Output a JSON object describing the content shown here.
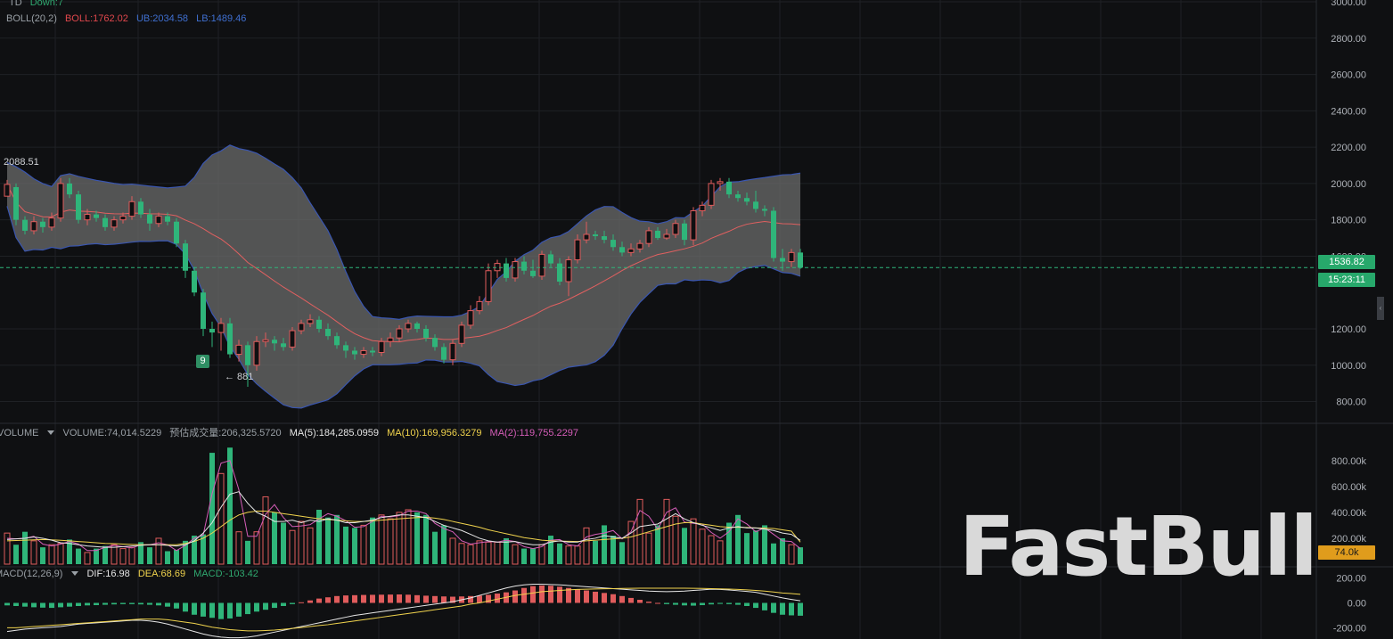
{
  "legend": {
    "td": "TD",
    "td_down": "Down:7",
    "boll_name": "BOLL(20,2)",
    "boll_mid": "BOLL:1762.02",
    "boll_ub": "UB:2034.58",
    "boll_lb": "LB:1489.46",
    "volume_name": "VOLUME",
    "volume_value": "VOLUME:74,014.5229",
    "volume_est": "预估成交量:206,325.5720",
    "ma5": "MA(5):184,285.0959",
    "ma10": "MA(10):169,956.3279",
    "ma2": "MA(2):119,755.2297",
    "macd_name": "MACD(12,26,9)",
    "dif": "DIF:16.98",
    "dea": "DEA:68.69",
    "macd": "MACD:-103.42"
  },
  "annotations": {
    "high": "2088.51",
    "low": "← 881",
    "td_count": "9"
  },
  "last_price": "1536.82",
  "countdown": "15:23:11",
  "last_volume": "74.0k",
  "watermark": "FastBull",
  "colors": {
    "up": "#e05c5c",
    "down": "#2fb57a",
    "boll_band": "#6b6b6b",
    "boll_edge": "#3a56b0",
    "boll_mid": "#e06060",
    "ma5": "#e6e6e6",
    "ma10": "#f0d34d",
    "ma2": "#d55db8",
    "grid": "#1f2125"
  },
  "chart_data": [
    {
      "type": "candlestick",
      "price_axis_ticks": [
        3000,
        2800,
        2600,
        2400,
        2200,
        2000,
        1800,
        1600,
        1200,
        1000,
        800
      ],
      "ylim": [
        680,
        3010
      ],
      "grid": true,
      "candles": [
        [
          1930,
          1995,
          1950,
          2020
        ],
        [
          1980,
          1800,
          1770,
          2000
        ],
        [
          1800,
          1740,
          1720,
          1820
        ],
        [
          1740,
          1790,
          1720,
          1820
        ],
        [
          1790,
          1760,
          1730,
          1810
        ],
        [
          1760,
          1810,
          1740,
          1840
        ],
        [
          1810,
          2000,
          1790,
          2030
        ],
        [
          2000,
          1940,
          1920,
          2030
        ],
        [
          1940,
          1800,
          1780,
          1960
        ],
        [
          1800,
          1830,
          1770,
          1860
        ],
        [
          1830,
          1810,
          1790,
          1850
        ],
        [
          1810,
          1760,
          1740,
          1830
        ],
        [
          1760,
          1800,
          1740,
          1820
        ],
        [
          1800,
          1820,
          1780,
          1840
        ],
        [
          1820,
          1900,
          1800,
          1930
        ],
        [
          1900,
          1830,
          1810,
          1920
        ],
        [
          1830,
          1780,
          1740,
          1860
        ],
        [
          1780,
          1820,
          1760,
          1840
        ],
        [
          1820,
          1790,
          1770,
          1840
        ],
        [
          1790,
          1670,
          1650,
          1810
        ],
        [
          1670,
          1520,
          1480,
          1690
        ],
        [
          1520,
          1400,
          1380,
          1540
        ],
        [
          1400,
          1200,
          1160,
          1420
        ],
        [
          1200,
          1180,
          1100,
          1240
        ],
        [
          1180,
          1230,
          1080,
          1260
        ],
        [
          1230,
          1060,
          1040,
          1260
        ],
        [
          1060,
          1110,
          1020,
          1140
        ],
        [
          1110,
          1000,
          881,
          1130
        ],
        [
          1000,
          1130,
          970,
          1160
        ],
        [
          1130,
          1140,
          1100,
          1180
        ],
        [
          1140,
          1120,
          1080,
          1160
        ],
        [
          1120,
          1100,
          1080,
          1150
        ],
        [
          1100,
          1190,
          1080,
          1210
        ],
        [
          1190,
          1230,
          1170,
          1250
        ],
        [
          1230,
          1250,
          1210,
          1280
        ],
        [
          1250,
          1200,
          1180,
          1270
        ],
        [
          1200,
          1160,
          1140,
          1230
        ],
        [
          1160,
          1110,
          1090,
          1180
        ],
        [
          1110,
          1080,
          1040,
          1130
        ],
        [
          1080,
          1060,
          1030,
          1100
        ],
        [
          1060,
          1080,
          1040,
          1100
        ],
        [
          1080,
          1070,
          1050,
          1100
        ],
        [
          1070,
          1130,
          1050,
          1150
        ],
        [
          1130,
          1150,
          1100,
          1180
        ],
        [
          1150,
          1200,
          1130,
          1220
        ],
        [
          1200,
          1230,
          1180,
          1250
        ],
        [
          1230,
          1200,
          1180,
          1240
        ],
        [
          1200,
          1150,
          1130,
          1220
        ],
        [
          1150,
          1100,
          1080,
          1170
        ],
        [
          1100,
          1030,
          1010,
          1120
        ],
        [
          1030,
          1120,
          1000,
          1140
        ],
        [
          1120,
          1220,
          1100,
          1240
        ],
        [
          1220,
          1300,
          1200,
          1330
        ],
        [
          1300,
          1350,
          1280,
          1380
        ],
        [
          1350,
          1520,
          1330,
          1560
        ],
        [
          1520,
          1560,
          1480,
          1580
        ],
        [
          1560,
          1480,
          1460,
          1590
        ],
        [
          1480,
          1570,
          1460,
          1590
        ],
        [
          1570,
          1520,
          1500,
          1600
        ],
        [
          1520,
          1490,
          1480,
          1580
        ],
        [
          1490,
          1610,
          1470,
          1630
        ],
        [
          1610,
          1560,
          1540,
          1630
        ],
        [
          1560,
          1460,
          1440,
          1590
        ],
        [
          1460,
          1580,
          1380,
          1600
        ],
        [
          1580,
          1690,
          1560,
          1720
        ],
        [
          1690,
          1720,
          1670,
          1790
        ],
        [
          1720,
          1710,
          1690,
          1740
        ],
        [
          1710,
          1690,
          1670,
          1740
        ],
        [
          1690,
          1650,
          1630,
          1720
        ],
        [
          1650,
          1620,
          1600,
          1680
        ],
        [
          1620,
          1640,
          1600,
          1670
        ],
        [
          1640,
          1670,
          1620,
          1690
        ],
        [
          1670,
          1740,
          1650,
          1760
        ],
        [
          1740,
          1700,
          1690,
          1760
        ],
        [
          1700,
          1720,
          1690,
          1750
        ],
        [
          1720,
          1780,
          1700,
          1800
        ],
        [
          1780,
          1690,
          1660,
          1800
        ],
        [
          1690,
          1850,
          1660,
          1870
        ],
        [
          1850,
          1880,
          1820,
          1900
        ],
        [
          1880,
          2000,
          1860,
          2020
        ],
        [
          2000,
          2010,
          1960,
          2030
        ],
        [
          2010,
          1940,
          1920,
          2030
        ],
        [
          1940,
          1920,
          1900,
          1960
        ],
        [
          1920,
          1900,
          1880,
          1950
        ],
        [
          1900,
          1860,
          1840,
          1960
        ],
        [
          1860,
          1850,
          1820,
          1880
        ],
        [
          1850,
          1590,
          1570,
          1870
        ],
        [
          1590,
          1570,
          1520,
          1640
        ],
        [
          1570,
          1620,
          1540,
          1640
        ],
        [
          1620,
          1537,
          1530,
          1640
        ]
      ]
    },
    {
      "type": "bar",
      "volume_axis_ticks": [
        "800.00k",
        "600.00k",
        "400.00k",
        "200.00k"
      ],
      "ylim": [
        0,
        950
      ],
      "volume": [
        240,
        150,
        250,
        180,
        130,
        150,
        160,
        190,
        120,
        90,
        120,
        140,
        150,
        120,
        130,
        170,
        130,
        200,
        100,
        110,
        180,
        220,
        230,
        860,
        700,
        900,
        250,
        180,
        250,
        520,
        400,
        320,
        260,
        330,
        280,
        420,
        360,
        380,
        290,
        280,
        300,
        360,
        380,
        350,
        400,
        420,
        400,
        380,
        250,
        300,
        200,
        160,
        150,
        180,
        170,
        170,
        200,
        150,
        120,
        120,
        150,
        220,
        160,
        140,
        140,
        280,
        180,
        300,
        220,
        170,
        330,
        500,
        240,
        300,
        500,
        370,
        280,
        350,
        270,
        220,
        180,
        320,
        380,
        240,
        260,
        300,
        160,
        200,
        150,
        130
      ],
      "ma5": [
        190,
        195,
        200,
        210,
        200,
        185,
        165,
        160,
        150,
        140,
        135,
        130,
        130,
        135,
        140,
        145,
        150,
        150,
        145,
        140,
        150,
        180,
        240,
        320,
        440,
        540,
        560,
        470,
        400,
        370,
        330,
        330,
        340,
        320,
        340,
        330,
        350,
        340,
        320,
        320,
        330,
        340,
        360,
        370,
        380,
        380,
        370,
        360,
        330,
        300,
        280,
        260,
        230,
        200,
        180,
        170,
        170,
        175,
        160,
        150,
        150,
        170,
        180,
        170,
        170,
        190,
        200,
        220,
        210,
        200,
        240,
        290,
        300,
        310,
        350,
        390,
        350,
        320,
        300,
        280,
        260,
        280,
        290,
        280,
        280,
        270,
        260,
        240,
        230,
        184
      ],
      "ma10": [
        180,
        182,
        185,
        188,
        190,
        188,
        184,
        180,
        175,
        170,
        165,
        160,
        158,
        155,
        152,
        150,
        150,
        150,
        150,
        150,
        160,
        175,
        200,
        240,
        290,
        340,
        380,
        400,
        410,
        410,
        400,
        390,
        380,
        370,
        360,
        350,
        345,
        340,
        335,
        330,
        330,
        335,
        340,
        345,
        350,
        355,
        360,
        362,
        355,
        345,
        330,
        315,
        300,
        285,
        265,
        250,
        235,
        220,
        205,
        195,
        185,
        180,
        178,
        176,
        175,
        180,
        185,
        190,
        195,
        200,
        210,
        230,
        250,
        270,
        290,
        310,
        320,
        320,
        310,
        300,
        290,
        285,
        285,
        283,
        280,
        278,
        275,
        265,
        255,
        170
      ],
      "ma2": [
        200,
        195,
        200,
        215,
        155,
        140,
        155,
        175,
        155,
        105,
        105,
        130,
        145,
        135,
        125,
        150,
        150,
        165,
        150,
        105,
        145,
        200,
        225,
        545,
        780,
        800,
        575,
        215,
        215,
        385,
        460,
        360,
        290,
        295,
        305,
        350,
        390,
        370,
        335,
        285,
        290,
        330,
        370,
        365,
        375,
        410,
        410,
        390,
        315,
        275,
        250,
        180,
        155,
        165,
        175,
        170,
        185,
        175,
        135,
        120,
        135,
        185,
        190,
        150,
        140,
        210,
        230,
        240,
        260,
        195,
        250,
        415,
        370,
        270,
        400,
        435,
        325,
        315,
        310,
        245,
        200,
        250,
        350,
        310,
        250,
        280,
        230,
        180,
        175,
        120
      ]
    },
    {
      "type": "bar",
      "macd_axis_ticks": [
        "200.00",
        "0.00",
        "-200.00"
      ],
      "ylim": [
        -290,
        290
      ],
      "macd": [
        -20,
        -25,
        -30,
        -35,
        -38,
        -40,
        -35,
        -30,
        -25,
        -20,
        -18,
        -15,
        -12,
        -10,
        -10,
        -12,
        -15,
        -20,
        -30,
        -45,
        -70,
        -95,
        -110,
        -120,
        -130,
        -125,
        -110,
        -90,
        -70,
        -55,
        -40,
        -25,
        -10,
        5,
        20,
        35,
        45,
        55,
        60,
        62,
        64,
        65,
        66,
        67,
        68,
        66,
        62,
        58,
        55,
        52,
        50,
        52,
        55,
        58,
        65,
        75,
        85,
        100,
        120,
        135,
        140,
        138,
        130,
        120,
        110,
        100,
        90,
        80,
        70,
        55,
        40,
        25,
        10,
        0,
        -10,
        -15,
        -20,
        -22,
        -18,
        -12,
        -8,
        -10,
        -15,
        -25,
        -40,
        -60,
        -80,
        -95,
        -100,
        -103
      ],
      "dif": [
        -230,
        -220,
        -210,
        -205,
        -200,
        -195,
        -190,
        -180,
        -170,
        -165,
        -160,
        -155,
        -150,
        -145,
        -140,
        -140,
        -145,
        -155,
        -170,
        -190,
        -210,
        -230,
        -250,
        -265,
        -275,
        -280,
        -280,
        -275,
        -265,
        -250,
        -235,
        -220,
        -205,
        -190,
        -175,
        -160,
        -145,
        -130,
        -115,
        -100,
        -90,
        -80,
        -70,
        -60,
        -50,
        -40,
        -30,
        -20,
        -10,
        0,
        10,
        25,
        40,
        60,
        80,
        100,
        120,
        135,
        145,
        150,
        150,
        148,
        145,
        140,
        135,
        130,
        125,
        120,
        115,
        110,
        105,
        100,
        95,
        92,
        90,
        92,
        95,
        100,
        105,
        110,
        108,
        104,
        98,
        92,
        85,
        70,
        55,
        40,
        28,
        17
      ],
      "dea": [
        -200,
        -200,
        -195,
        -190,
        -185,
        -180,
        -175,
        -170,
        -165,
        -160,
        -155,
        -150,
        -145,
        -140,
        -135,
        -130,
        -130,
        -130,
        -135,
        -145,
        -155,
        -165,
        -180,
        -195,
        -205,
        -215,
        -220,
        -225,
        -225,
        -222,
        -218,
        -212,
        -205,
        -198,
        -190,
        -182,
        -175,
        -165,
        -155,
        -145,
        -135,
        -125,
        -115,
        -105,
        -95,
        -85,
        -75,
        -65,
        -55,
        -45,
        -35,
        -25,
        -10,
        0,
        15,
        30,
        45,
        60,
        70,
        80,
        90,
        95,
        100,
        105,
        108,
        110,
        112,
        114,
        115,
        116,
        117,
        118,
        118,
        118,
        118,
        118,
        118,
        117,
        116,
        115,
        113,
        111,
        108,
        105,
        100,
        95,
        88,
        80,
        75,
        69
      ]
    }
  ]
}
